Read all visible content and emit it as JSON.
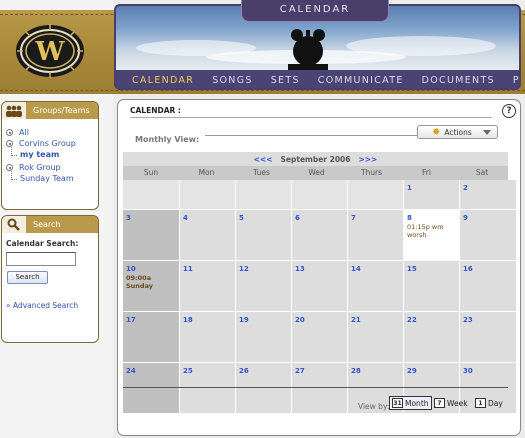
{
  "header": {
    "section_title": "CALENDAR",
    "nav": [
      "CALENDAR",
      "SONGS",
      "SETS",
      "COMMUNICATE",
      "DOCUMENTS",
      "PEOPLE"
    ],
    "active_nav": "CALENDAR",
    "logo_letter": "W"
  },
  "groups_panel": {
    "title": "Groups/Teams",
    "items": [
      {
        "label": "All",
        "level": 0
      },
      {
        "label": "Corvins Group",
        "level": 0
      },
      {
        "label": "my team",
        "level": 1,
        "bold": true
      },
      {
        "label": "Rok Group",
        "level": 0
      },
      {
        "label": "Sunday Team",
        "level": 1
      }
    ]
  },
  "search_panel": {
    "title": "Search",
    "label": "Calendar Search:",
    "input_value": "",
    "button": "Search",
    "advanced_link": "» Advanced Search"
  },
  "main": {
    "title": "CALENDAR :",
    "help": "?",
    "view_heading": "Monthly View:",
    "actions_label": "Actions",
    "prev_arrows": "<<<",
    "next_arrows": ">>>",
    "month_label": "September 2006",
    "weekdays": [
      "Sun",
      "Mon",
      "Tues",
      "Wed",
      "Thurs",
      "Fri",
      "Sat"
    ],
    "weeks": [
      [
        null,
        null,
        null,
        null,
        null,
        {
          "day": "1"
        },
        {
          "day": "2"
        }
      ],
      [
        {
          "day": "3"
        },
        {
          "day": "4"
        },
        {
          "day": "5"
        },
        {
          "day": "6"
        },
        {
          "day": "7"
        },
        {
          "day": "8",
          "selected": true,
          "events": [
            {
              "text": "01:15p wm worsh",
              "bold": false
            }
          ]
        },
        {
          "day": "9"
        }
      ],
      [
        {
          "day": "10",
          "events": [
            {
              "text": "09:00a Sunday",
              "bold": true
            }
          ]
        },
        {
          "day": "11"
        },
        {
          "day": "12"
        },
        {
          "day": "13"
        },
        {
          "day": "14"
        },
        {
          "day": "15"
        },
        {
          "day": "16"
        }
      ],
      [
        {
          "day": "17"
        },
        {
          "day": "18"
        },
        {
          "day": "19"
        },
        {
          "day": "20"
        },
        {
          "day": "21"
        },
        {
          "day": "22"
        },
        {
          "day": "23"
        }
      ],
      [
        {
          "day": "24"
        },
        {
          "day": "25"
        },
        {
          "day": "26"
        },
        {
          "day": "27"
        },
        {
          "day": "28"
        },
        {
          "day": "29"
        },
        {
          "day": "30"
        }
      ]
    ],
    "view_by": {
      "label": "View by:",
      "month": "Month",
      "month_icon": "31",
      "week": "Week",
      "week_icon": "7",
      "day": "Day",
      "day_icon": "1",
      "selected": "Month"
    }
  },
  "colors": {
    "gold": "#b89a4a",
    "nav_purple": "#4a4475",
    "active_nav": "#f0c75a",
    "link_blue": "#3355cc"
  }
}
